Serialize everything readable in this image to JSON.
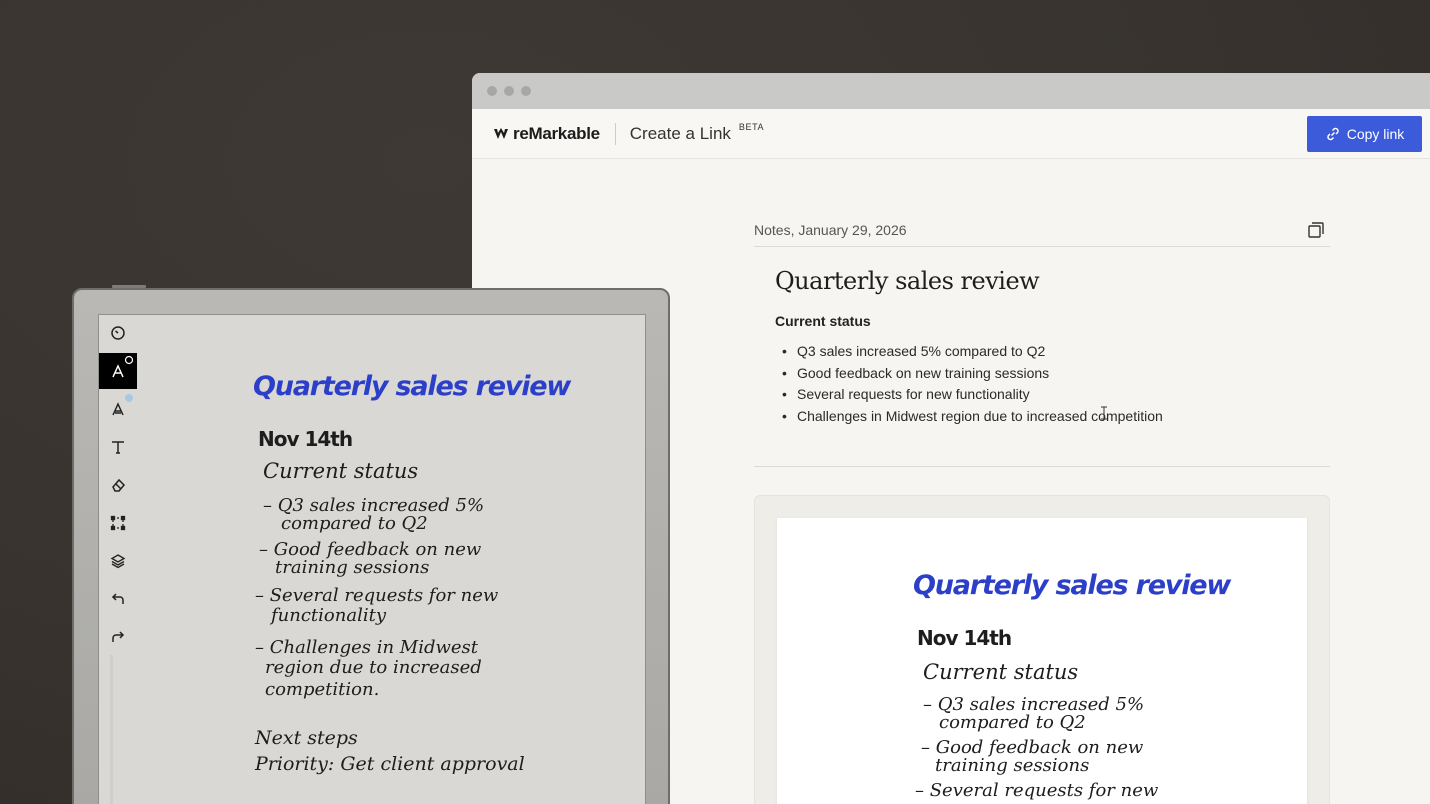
{
  "browser": {
    "brand_name": "reMarkable",
    "app_title": "Create a Link",
    "beta_label": "BETA",
    "copy_button_label": "Copy link"
  },
  "document": {
    "meta_date": "Notes, January 29, 2026",
    "title": "Quarterly sales review",
    "section_heading": "Current status",
    "bullets": [
      "Q3 sales increased 5% compared to Q2",
      "Good feedback on new training sessions",
      "Several requests for new functionality",
      "Challenges in Midwest region due to increased competition"
    ]
  },
  "handwriting": {
    "title": "Quarterly sales review",
    "date": "Nov 14th",
    "heading": "Current status",
    "lines": [
      "– Q3 sales increased 5%",
      "compared to Q2",
      "– Good feedback on new",
      "training sessions",
      "– Several requests for new",
      "functionality",
      "– Challenges in Midwest",
      "region due to increased",
      "competition."
    ],
    "next_heading": "Next steps",
    "next_line": "Priority: Get client approval"
  },
  "colors": {
    "accent": "#3b5bdb",
    "ink_blue": "#2c3fc9"
  },
  "tablet_tools": [
    "clock-icon",
    "pen-icon",
    "highlighter-icon",
    "text-icon",
    "eraser-icon",
    "selection-icon",
    "layers-icon",
    "undo-icon",
    "redo-icon"
  ]
}
